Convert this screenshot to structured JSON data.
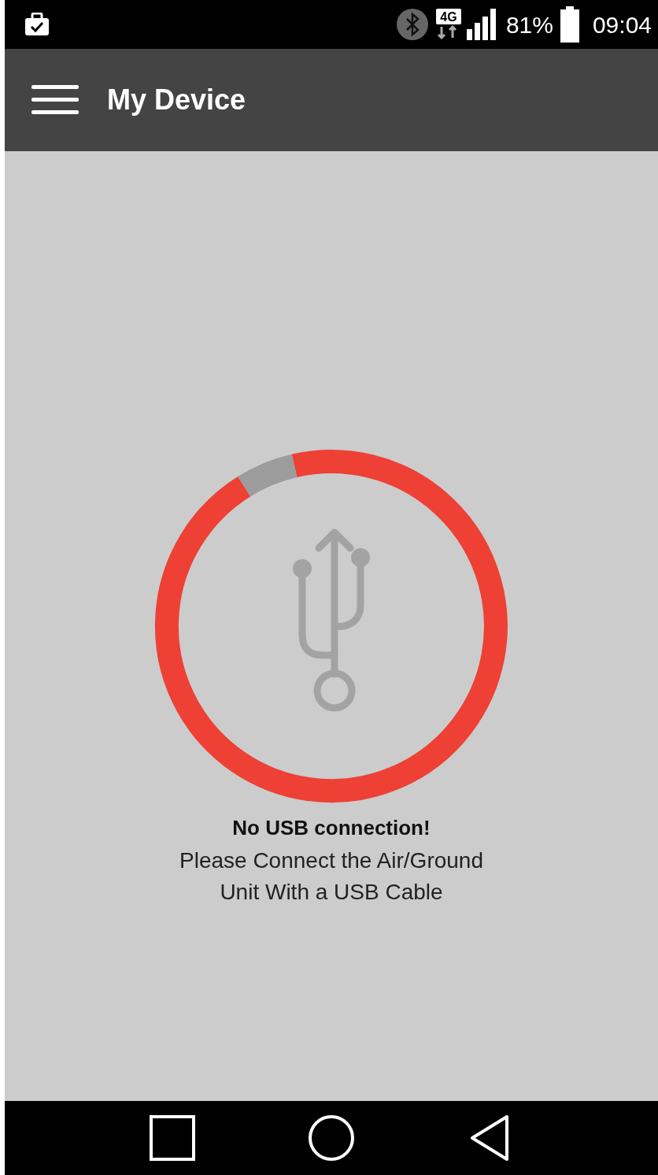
{
  "status_bar": {
    "network": "4G",
    "battery": "81%",
    "time": "09:04"
  },
  "app_bar": {
    "title": "My Device"
  },
  "message": {
    "title": "No USB connection!",
    "text": "Please Connect the Air/Ground\nUnit With a USB Cable"
  },
  "nav_bar": {
    "buttons": [
      {
        "kind": "recents"
      },
      {
        "kind": "home"
      },
      {
        "kind": "back"
      }
    ]
  }
}
